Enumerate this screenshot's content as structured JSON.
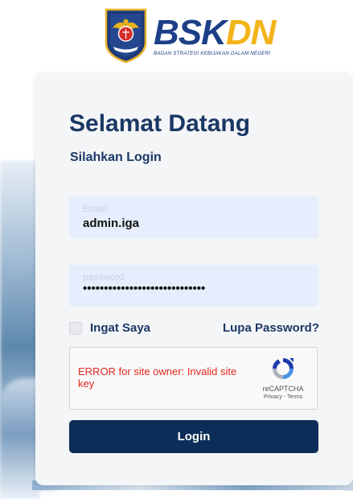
{
  "header": {
    "brand_prefix": "BSK",
    "brand_highlight": "DN",
    "brand_subtitle": "BADAN STRATEGI KEBIJAKAN DALAM NEGERI"
  },
  "login": {
    "title": "Selamat Datang",
    "subtitle": "Silahkan Login",
    "email_label": "Email",
    "email_value": "admin.iga",
    "password_label": "password",
    "password_value": "•••••••••••••••••••••••••••••",
    "remember_label": "Ingat Saya",
    "forgot_label": "Lupa Password?",
    "login_button": "Login"
  },
  "recaptcha": {
    "error": "ERROR for site owner: Invalid site key",
    "name": "reCAPTCHA",
    "links": "Privacy - Terms"
  },
  "colors": {
    "primary": "#0c2d57",
    "heading": "#1b3864",
    "brand_blue": "#1c3f87",
    "brand_yellow": "#f2b418",
    "error": "#e0281e",
    "field_bg": "#e6eefd"
  },
  "icons": [
    "garuda-emblem-icon",
    "recaptcha-icon"
  ]
}
